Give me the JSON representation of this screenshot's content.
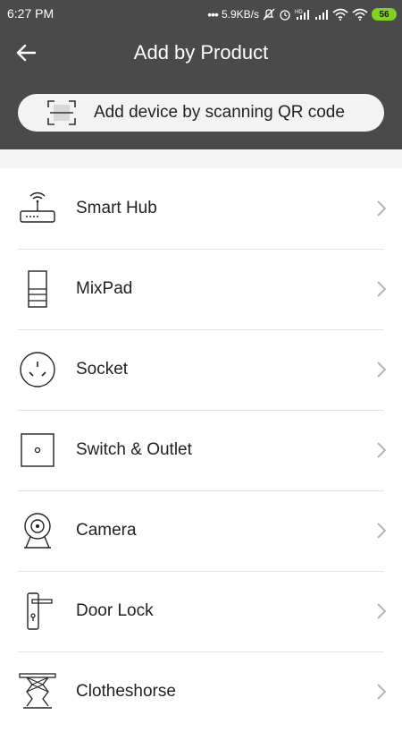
{
  "status_bar": {
    "time": "6:27 PM",
    "network_speed": "5.9KB/s",
    "battery_level": "56"
  },
  "nav": {
    "title": "Add by Product"
  },
  "scan": {
    "label": "Add device by scanning QR code"
  },
  "products": [
    {
      "label": "Smart Hub",
      "icon": "smart-hub-icon"
    },
    {
      "label": "MixPad",
      "icon": "mixpad-icon"
    },
    {
      "label": "Socket",
      "icon": "socket-icon"
    },
    {
      "label": "Switch & Outlet",
      "icon": "switch-icon"
    },
    {
      "label": "Camera",
      "icon": "camera-icon"
    },
    {
      "label": "Door Lock",
      "icon": "door-lock-icon"
    },
    {
      "label": "Clotheshorse",
      "icon": "clotheshorse-icon"
    }
  ],
  "colors": {
    "header_bg": "#4a4a4a",
    "battery": "#7ed321",
    "divider": "#e3e3e3"
  }
}
